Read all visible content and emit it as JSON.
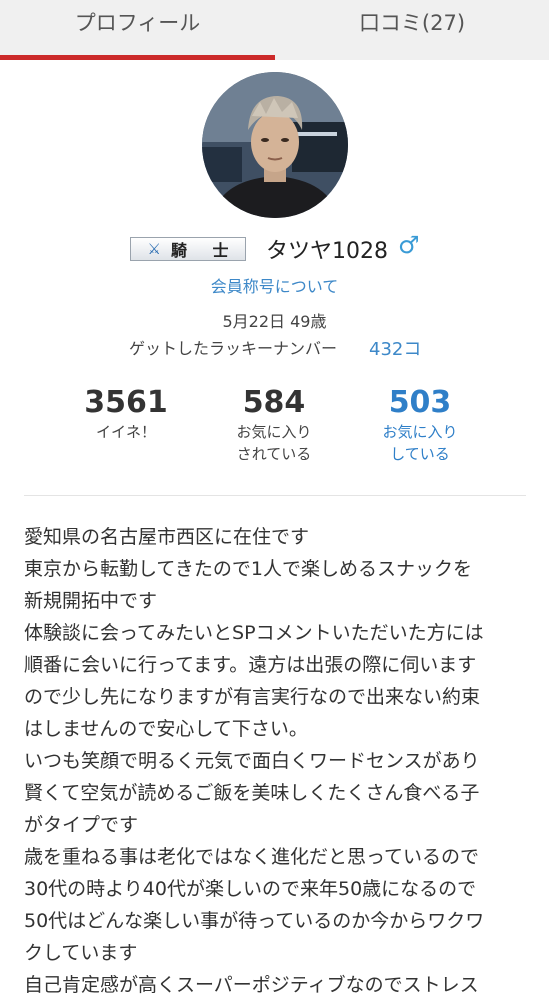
{
  "tabs": [
    {
      "label": "プロフィール"
    },
    {
      "label": "口コミ(27)"
    }
  ],
  "profile": {
    "rank_label": "騎 士",
    "username": "タツヤ1028",
    "gender_symbol": "♂",
    "title_link": "会員称号について",
    "birthday_age": "5月22日 49歳",
    "lucky_number_label": "ゲットしたラッキーナンバー",
    "lucky_number_value": "432コ"
  },
  "stats": {
    "likes": {
      "value": "3561",
      "label": "イイネ！"
    },
    "favorited_by": {
      "value": "584",
      "label_line1": "お気に入り",
      "label_line2": "されている"
    },
    "favorites": {
      "value": "503",
      "label_line1": "お気に入り",
      "label_line2": "している"
    }
  },
  "bio_lines": [
    "愛知県の名古屋市西区に在住です",
    "東京から転勤してきたので1人で楽しめるスナックを",
    "新規開拓中です",
    "体験談に会ってみたいとSPコメントいただいた方には",
    "順番に会いに行ってます。遠方は出張の際に伺います",
    "ので少し先になりますが有言実行なので出来ない約束",
    "はしませんので安心して下さい。",
    "いつも笑顔で明るく元気で面白くワードセンスがあり",
    "賢くて空気が読めるご飯を美味しくたくさん食べる子",
    "がタイプです",
    "歳を重ねる事は老化ではなく進化だと思っているので",
    "30代の時より40代が楽しいので来年50歳になるので",
    "50代はどんな楽しい事が待っているのか今からワクワ",
    "クしています",
    "自己肯定感が高くスーパーポジティブなのでストレス"
  ],
  "colors": {
    "accent_red": "#cc2a2a",
    "link_blue": "#3d88c8",
    "gender_blue": "#3a9bd6"
  },
  "icons": {
    "rank": "crossed-swords-icon",
    "gender": "male-symbol-icon"
  }
}
